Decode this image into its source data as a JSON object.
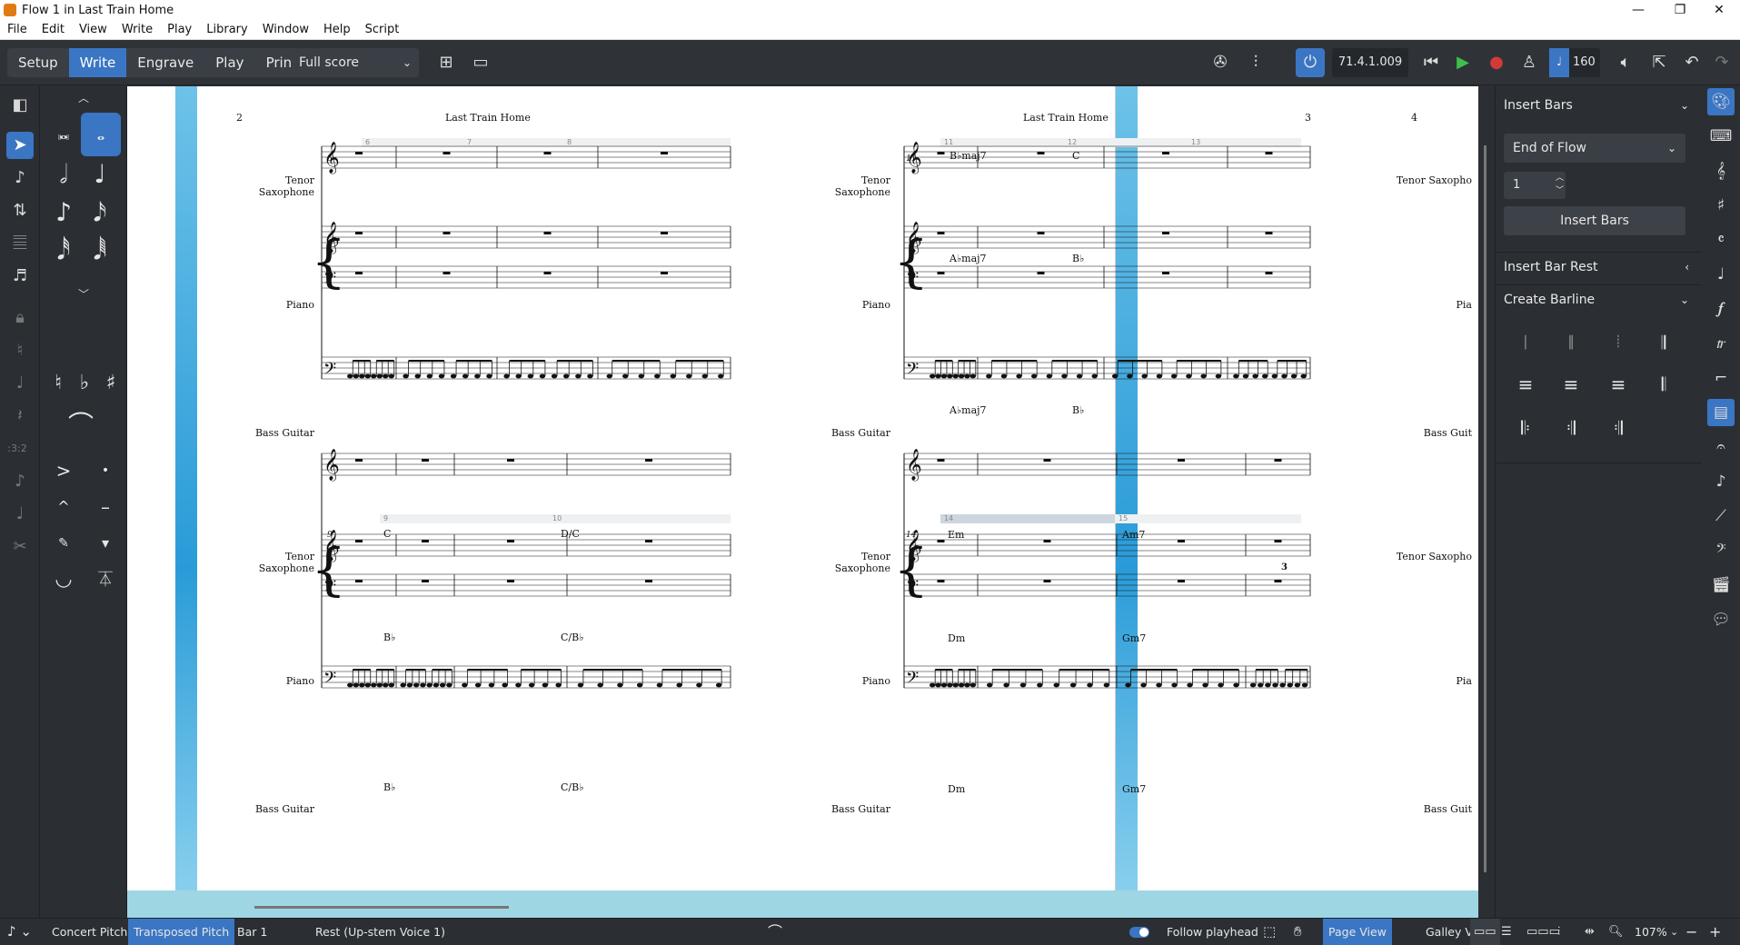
{
  "window": {
    "title": "Flow 1 in Last Train Home"
  },
  "menu": [
    "File",
    "Edit",
    "View",
    "Write",
    "Play",
    "Library",
    "Window",
    "Help",
    "Script"
  ],
  "modes": [
    {
      "label": "Setup",
      "active": false
    },
    {
      "label": "Write",
      "active": true
    },
    {
      "label": "Engrave",
      "active": false
    },
    {
      "label": "Play",
      "active": false
    },
    {
      "label": "Print",
      "active": false
    }
  ],
  "layout_select": {
    "value": "Full score"
  },
  "transport": {
    "timecode": "71.4.1.009",
    "tempo": "160"
  },
  "score": {
    "header_title": "Last Train Home",
    "pages": [
      {
        "number": "2"
      },
      {
        "number": "3"
      },
      {
        "number": "4"
      }
    ],
    "instruments": [
      "Tenor Saxophone",
      "Piano",
      "Bass Guitar"
    ],
    "instruments_cut": [
      "Tenor Saxopho",
      "Pia",
      "Bass Guit"
    ],
    "bar_numbers": {
      "p2s1": [
        "6",
        "7",
        "8"
      ],
      "p2s2": [
        "9",
        "10"
      ],
      "p3s1": [
        "11",
        "12",
        "13"
      ],
      "p3s2": [
        "14",
        "15"
      ]
    },
    "system_start_bars": {
      "p2s1": "6",
      "p2s2": "9",
      "p3s1": "11",
      "p3s2": "14"
    },
    "chords": {
      "p2s2_sax": [
        "C",
        "D/C"
      ],
      "p2s2_piano": [
        "B♭",
        "C/B♭"
      ],
      "p2s2_bass": [
        "B♭",
        "C/B♭"
      ],
      "p3s1_sax": [
        "B♭maj7",
        "C"
      ],
      "p3s1_piano": [
        "A♭maj7",
        "B♭"
      ],
      "p3s1_bass": [
        "A♭maj7",
        "B♭"
      ],
      "p3s2_sax": [
        "Em",
        "Am7"
      ],
      "p3s2_piano": [
        "Dm",
        "Gm7"
      ],
      "p3s2_bass": [
        "Dm",
        "Gm7"
      ]
    },
    "tuplet": "3"
  },
  "right_panel": {
    "insert_bars": {
      "heading": "Insert Bars",
      "position": "End of Flow",
      "count": "1",
      "button": "Insert Bars"
    },
    "insert_bar_rest": {
      "heading": "Insert Bar Rest"
    },
    "create_barline": {
      "heading": "Create Barline"
    }
  },
  "status": {
    "concert": "Concert Pitch",
    "transposed": "Transposed Pitch",
    "bar": "Bar 1",
    "selection": "Rest (Up-stem Voice 1)",
    "follow": "Follow playhead",
    "page_view": "Page View",
    "galley_view": "Galley View",
    "zoom": "107%"
  }
}
